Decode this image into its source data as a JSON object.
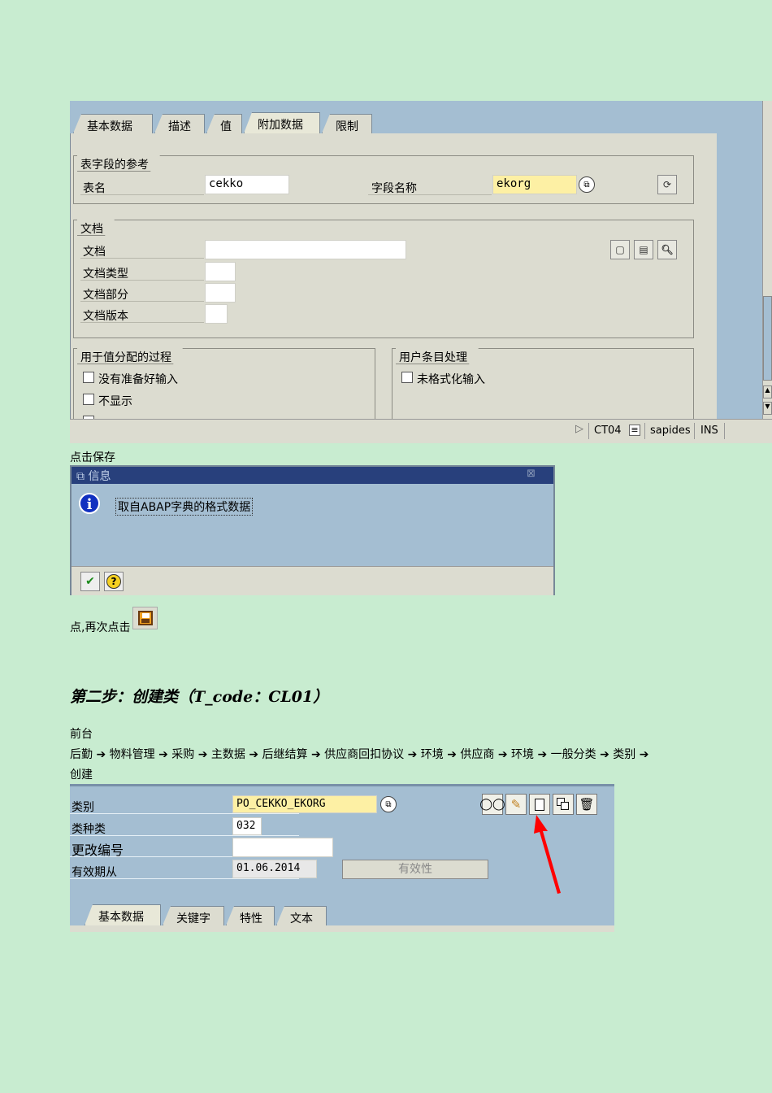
{
  "shot1": {
    "tabs": [
      "基本数据",
      "描述",
      "值",
      "附加数据",
      "限制"
    ],
    "active_tab": "附加数据",
    "ref_group": {
      "title": "表字段的参考",
      "table_label": "表名",
      "table_value": "cekko",
      "field_label": "字段名称",
      "field_value": "ekorg"
    },
    "doc_group": {
      "title": "文档",
      "labels": [
        "文档",
        "文档类型",
        "文档部分",
        "文档版本"
      ]
    },
    "proc_group": {
      "title": "用于值分配的过程",
      "items": [
        "没有准备好输入",
        "不显示"
      ]
    },
    "user_group": {
      "title": "用户条目处理",
      "items": [
        "未格式化输入"
      ]
    },
    "status": {
      "tcode": "CT04",
      "server": "sapides",
      "mode": "INS"
    }
  },
  "caption1": "点击保存",
  "dialog": {
    "title": "信息",
    "message": "取自ABAP字典的格式数据"
  },
  "caption2": "点,再次点击",
  "step_heading": "第二步：创建类（T_code：CL01）",
  "nav": {
    "line1": "前台",
    "line2": "后勤 ➔ 物料管理 ➔ 采购 ➔ 主数据 ➔ 后继结算 ➔ 供应商回扣协议 ➔ 环境 ➔ 供应商 ➔ 环境 ➔ 一般分类 ➔ 类别 ➔",
    "line3": "创建"
  },
  "shot2": {
    "labels": {
      "class": "类别",
      "class_type": "类种类",
      "change_no": "更改编号",
      "valid_from": "有效期从"
    },
    "values": {
      "class": "PO_CEKKO_EKORG",
      "class_type": "032",
      "change_no": "",
      "valid_from": "01.06.2014"
    },
    "validity_button": "有效性",
    "tabs": [
      "基本数据",
      "关键字",
      "特性",
      "文本"
    ],
    "active_tab": "基本数据"
  },
  "colors": {
    "page_bg": "#c8ecd0",
    "sap_blue": "#a4bed2",
    "sap_grey": "#dcdcd0",
    "dialog_title": "#28407c",
    "required_yellow": "#fdf0a4",
    "arrow_red": "#ff0000"
  }
}
